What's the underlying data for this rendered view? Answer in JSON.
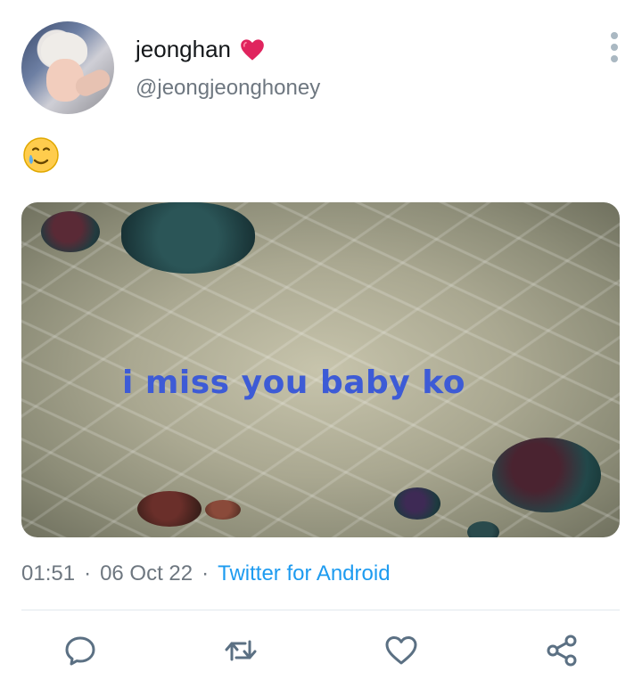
{
  "tweet": {
    "author": {
      "display_name": "jeonghan",
      "name_emoji": "heart-icon",
      "handle": "@jeongjeonghoney"
    },
    "text_emoji": "🥲",
    "media": {
      "caption": "i miss you baby ko"
    },
    "meta": {
      "time": "01:51",
      "date": "06 Oct 22",
      "source": "Twitter for Android",
      "separator": "·"
    },
    "actions": [
      "reply-icon",
      "retweet-icon",
      "like-icon",
      "share-icon"
    ]
  },
  "colors": {
    "link": "#1d9bf0",
    "secondary_text": "#6e7780",
    "heart": "#e0245e",
    "caption": "#3d5bd6"
  }
}
